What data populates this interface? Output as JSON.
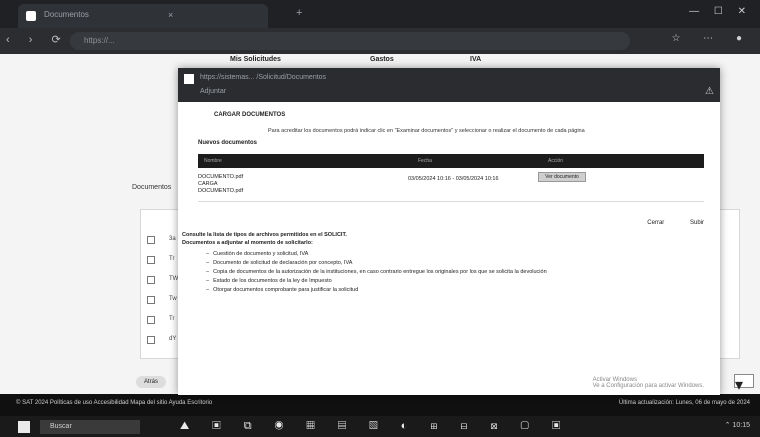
{
  "browser": {
    "tab_title": "Documentos",
    "tab_close": "×",
    "new_tab": "+",
    "address": "https://...",
    "nav_glyphs": "‹ › ⟳",
    "window_controls": "— ☐ ✕",
    "toolbar_icons": "☆ ⋯ ●"
  },
  "page": {
    "nav": [
      "Mis Solicitudes",
      "Gastos",
      "IVA"
    ],
    "documents_heading": "Documentos",
    "rows": [
      "3a",
      "Tr",
      "TW",
      "Tw",
      "Tr",
      "dY"
    ],
    "bottom_button": "Atrás",
    "select_glyph": "▾"
  },
  "modal": {
    "url": "https://sistemas... /Solicitud/Documentos",
    "subtitle": "Adjuntar",
    "warning": "⚠",
    "heading": "CARGAR DOCUMENTOS",
    "info": "Para acreditar los documentos podrá indicar clic en \"Examinar documentos\" y seleccionar o realizar el documento de cada página",
    "files_label": "Nuevos documentos",
    "table_headers": [
      "Nombre",
      "Fecha",
      "Acción"
    ],
    "file_name": "DOCUMENTO.pdf\nCARGA\nDOCUMENTO.pdf",
    "file_date": "03/05/2024 10:16 - 03/05/2024 10:16",
    "file_button": "Ver documento",
    "links": [
      "Cerrar",
      "Subir"
    ],
    "note": "Consulte la lista de tipos de archivos permitidos en el SOLICIT.",
    "note_sub": "Documentos a adjuntar al momento de solicitarlo:",
    "list": [
      "Cuestión de documento y solicitud, IVA",
      "Documento de solicitud de declaración por concepto, IVA",
      "Copia de documentos de la autorización de la instituciones, en caso contrario entregue los originales por los que se solicita la devolución",
      "Estado de los documentos de la ley de Impuesto",
      "Otorgar documentos comprobante para justificar la solicitud"
    ],
    "footer": "Activar Windows\nVe a Configuración para activar Windows."
  },
  "statusbar": {
    "left": "© SAT 2024   Políticas de uso   Accesibilidad   Mapa del sitio   Ayuda   Escritorio",
    "right": "Última actualización: Lunes, 06 de mayo de 2024"
  },
  "taskbar": {
    "search": "Buscar",
    "apps": "⛰ ▣ ⧉ ◉ ▦ ▤ ▧ ◐ ⊞ ⊟ ⊠ ▢ ▣",
    "tray": "⌃ 10:15"
  }
}
